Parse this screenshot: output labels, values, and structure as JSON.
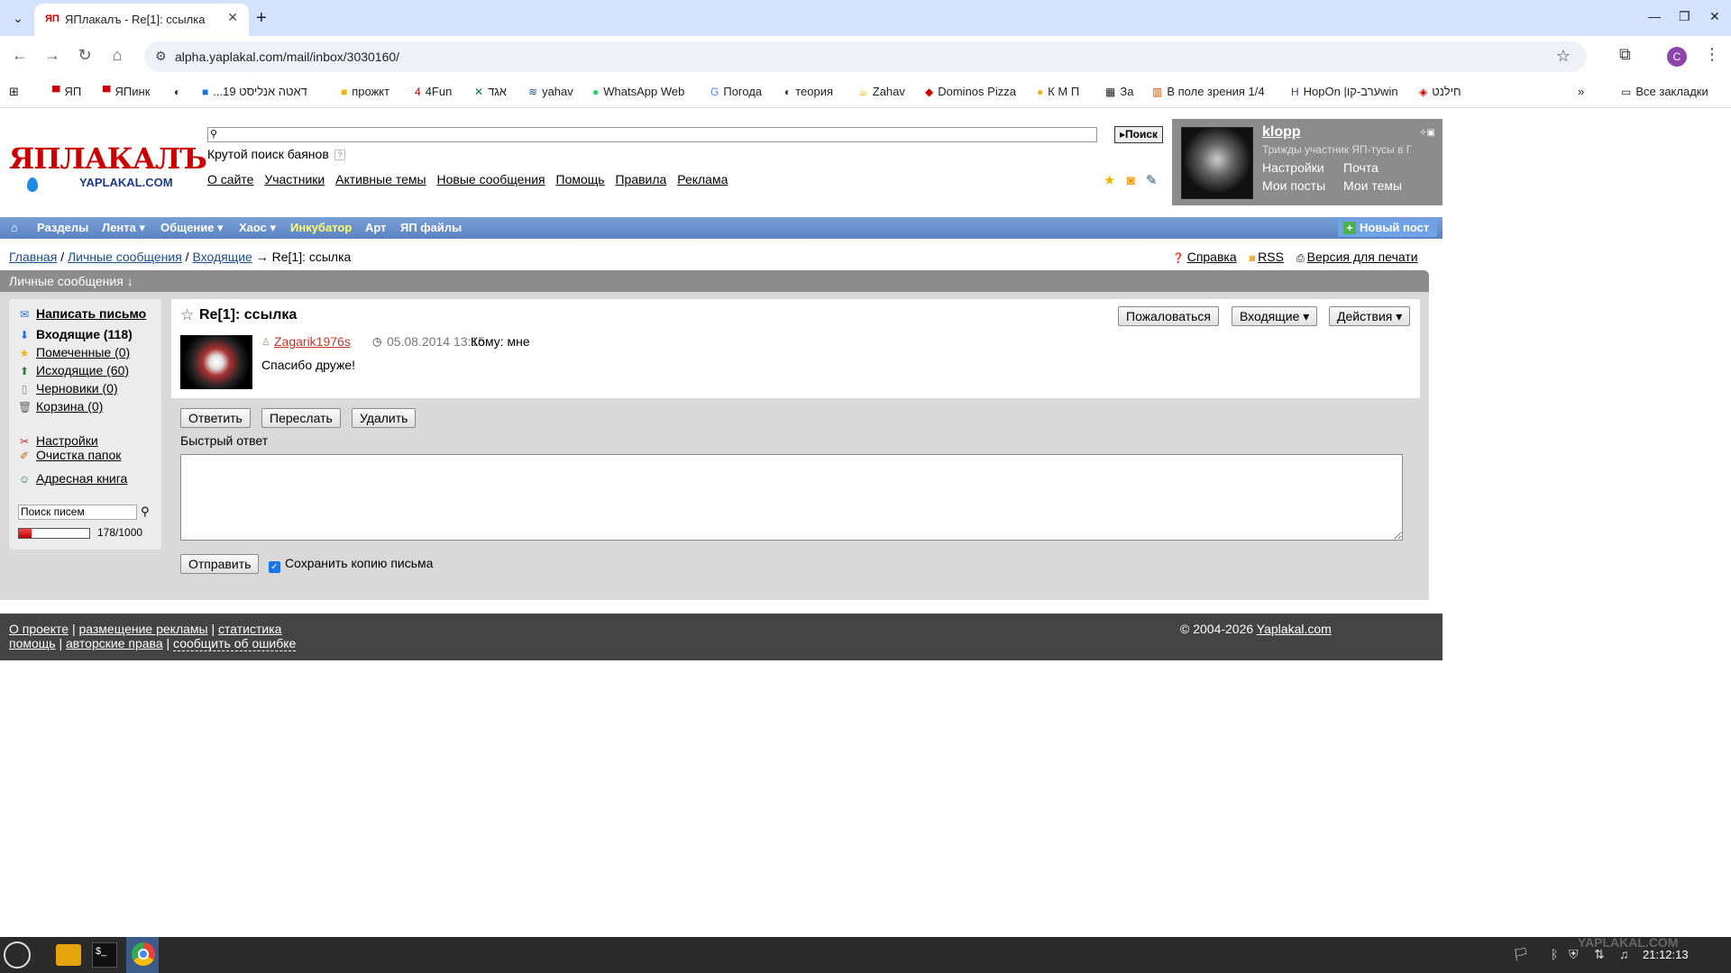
{
  "browser": {
    "tab_title": "ЯПлакалъ - Re[1]: ссылка",
    "tab_favicon": "ЯП",
    "url": "alpha.yaplakal.com/mail/inbox/3030160/",
    "profile_initial": "C",
    "bookmarks": [
      "ЯП",
      "ЯПинк",
      "...דאטה אנליסט 19",
      "прожкт",
      "4Fun",
      "אגד",
      "yahav",
      "WhatsApp Web",
      "Погода",
      "теория",
      "Zahav",
      "Dominos Pizza",
      "К М П",
      "За",
      "В поле зрения 1/4",
      "HopOn |ערב-קוwin",
      "חילנט"
    ],
    "all_bookmarks": "Все закладки"
  },
  "header": {
    "logo_main": "ЯПЛАКАЛЪ",
    "logo_sub": "YAPLAKAL.COM",
    "search_button": "Поиск",
    "search_hint": "Крутой поиск баянов",
    "links": [
      "О сайте",
      "Участники",
      "Активные темы",
      "Новые сообщения",
      "Помощь",
      "Правила",
      "Реклама"
    ]
  },
  "user": {
    "name": "klopp",
    "status": "Трижды участник ЯП-тусы в Г",
    "settings": "Настройки",
    "mail": "Почта",
    "my_posts": "Мои посты",
    "my_topics": "Мои темы"
  },
  "navbar": {
    "items": [
      "Разделы",
      "Лента ▾",
      "Общение ▾",
      "Хаос ▾",
      "Инкубатор",
      "Арт",
      "ЯП файлы"
    ],
    "highlight_color": "#ffff66",
    "new_post": "Новый пост"
  },
  "breadcrumb": {
    "home": "Главная",
    "pm": "Личные сообщения",
    "inbox": "Входящие",
    "separator1": "/",
    "separator2": "/",
    "arrow": "→",
    "current": "Re[1]: ссылка",
    "help": "Справка",
    "rss": "RSS",
    "print": "Версия для печати"
  },
  "section_title": "Личные сообщения ↓",
  "sidebar": {
    "compose": "Написать письмо",
    "folders": [
      {
        "label": "Входящие (118)",
        "bold": true
      },
      {
        "label": "Помеченные (0)"
      },
      {
        "label": "Исходящие (60)"
      },
      {
        "label": "Черновики (0)"
      },
      {
        "label": "Корзина (0)"
      }
    ],
    "settings": "Настройки",
    "clean": "Очистка папок",
    "address_book": "Адресная книга",
    "search_placeholder": "Поиск писем",
    "quota_text": "178/1000",
    "quota_fraction": 0.178
  },
  "message": {
    "subject": "Re[1]: ссылка",
    "report_btn": "Пожаловаться",
    "folder_btn": "Входящие ▾",
    "actions_btn": "Действия ▾",
    "sender": "Zagarik1976s",
    "date": "05.08.2014 13:15",
    "to": "Кому: мне",
    "body": "Спасибо друже!",
    "reply_btn": "Ответить",
    "forward_btn": "Переслать",
    "delete_btn": "Удалить",
    "quick_reply": "Быстрый ответ",
    "send_btn": "Отправить",
    "save_copy": "Сохранить копию письма"
  },
  "footer": {
    "about": "О проекте",
    "ads": "размещение рекламы",
    "stats": "статистика",
    "help": "помощь",
    "copyright_link": "авторские права",
    "report_error": "сообщить об ошибке",
    "copyright": "© 2004-2026",
    "site": "Yaplakal.com",
    "sep": "|"
  },
  "taskbar": {
    "time": "21:12:13",
    "watermark": "YAPLAKAL.COM"
  }
}
